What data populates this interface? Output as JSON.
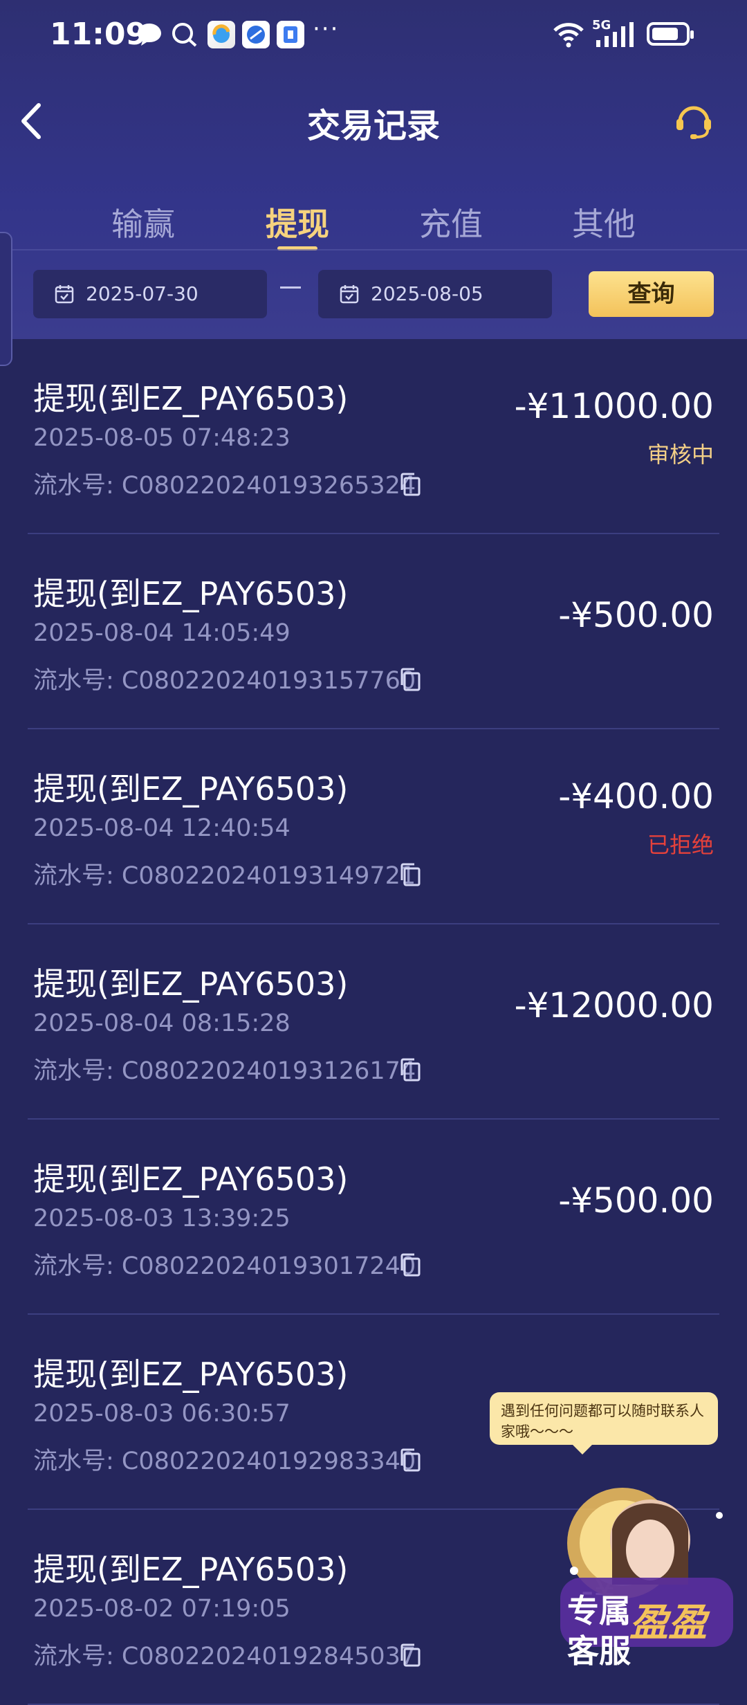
{
  "status_bar": {
    "time": "11:09",
    "network": "5G",
    "battery_level": 0.8,
    "more": "···"
  },
  "header": {
    "title": "交易记录",
    "back_icon": "chevron-left-icon",
    "support_icon": "headset-icon"
  },
  "tabs": [
    {
      "label": "输赢",
      "active": false
    },
    {
      "label": "提现",
      "active": true
    },
    {
      "label": "充值",
      "active": false
    },
    {
      "label": "其他",
      "active": false
    }
  ],
  "date_filter": {
    "start_date": "2025-07-30",
    "separator": "—",
    "end_date": "2025-08-05",
    "query_label": "查询"
  },
  "colors": {
    "accent": "#f6d37e",
    "pending": "#f3cf87",
    "rejected": "#e5413b",
    "background": "#25265c"
  },
  "records": [
    {
      "title": "提现(到EZ_PAY6503)",
      "time": "2025-08-05 07:48:23",
      "serial": "流水号: C08022024019326532­4",
      "amount": "-¥11000.00",
      "status": "审核中",
      "status_type": "pending"
    },
    {
      "title": "提现(到EZ_PAY6503)",
      "time": "2025-08-04 14:05:49",
      "serial": "流水号: C08022024019315776­0",
      "amount": "-¥500.00",
      "status": "",
      "status_type": ""
    },
    {
      "title": "提现(到EZ_PAY6503)",
      "time": "2025-08-04 12:40:54",
      "serial": "流水号: C08022024019314972­1",
      "amount": "-¥400.00",
      "status": "已拒绝",
      "status_type": "rejected"
    },
    {
      "title": "提现(到EZ_PAY6503)",
      "time": "2025-08-04 08:15:28",
      "serial": "流水号: C08022024019312617­4",
      "amount": "-¥12000.00",
      "status": "",
      "status_type": ""
    },
    {
      "title": "提现(到EZ_PAY6503)",
      "time": "2025-08-03 13:39:25",
      "serial": "流水号: C08022024019301724­0",
      "amount": "-¥500.00",
      "status": "",
      "status_type": ""
    },
    {
      "title": "提现(到EZ_PAY6503)",
      "time": "2025-08-03 06:30:57",
      "serial": "流水号: C08022024019298334­0",
      "amount": "",
      "status": "",
      "status_type": ""
    },
    {
      "title": "提现(到EZ_PAY6503)",
      "time": "2025-08-02 07:19:05",
      "serial": "流水号: C08022024019284503­7",
      "amount": "-¥",
      "status": "",
      "status_type": ""
    }
  ],
  "support_popup": {
    "bubble_text": "遇到任何问题都可以随时联系人家哦～～～",
    "badge_line1": "专属",
    "badge_line2": "客服",
    "badge_name": "盈盈"
  }
}
